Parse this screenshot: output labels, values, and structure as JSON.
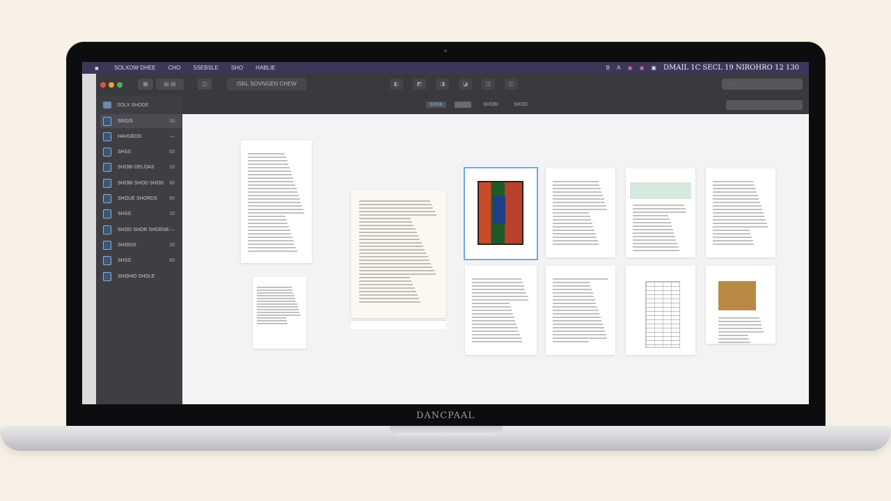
{
  "menubar": {
    "apple_glyph": "■",
    "menus": [
      "SOLXOW DHEE",
      "CHO",
      "SSEBSLE",
      "SHO",
      "HABLIE"
    ],
    "status_icons": [
      "B",
      "A",
      "◉",
      "◉",
      "▣"
    ],
    "clock": "DMAIL 1C SECL 19 NIROHRO  12  130"
  },
  "toolbar": {
    "traffic_colors": [
      "#e0523f",
      "#e6a52a",
      "#4bb35a"
    ],
    "buttons": [
      "▦",
      "▤ ▤",
      "◫"
    ],
    "title": "ISKL SOVNGEN CHEW",
    "center_buttons": [
      "◧",
      "◩",
      "◨",
      "◪",
      "◫",
      "◰"
    ],
    "search_placeholder": "◌  ◌"
  },
  "sidebar": {
    "header": "SOLX SHODE",
    "items": [
      {
        "label": "SRGIS",
        "count": "10",
        "active": true
      },
      {
        "label": "HAVGEOS",
        "count": "—",
        "active": false
      },
      {
        "label": "SHSS",
        "count": "63",
        "active": false
      },
      {
        "label": "SHOBI GELOAS",
        "count": "10",
        "active": false
      },
      {
        "label": "SHOBI SHOD SHOD",
        "count": "60",
        "active": false
      },
      {
        "label": "SHOUE SHORDS",
        "count": "60",
        "active": false
      },
      {
        "label": "SHSS",
        "count": "10",
        "active": false
      },
      {
        "label": "SHOD SHOR SHOENE",
        "count": "—",
        "active": false
      },
      {
        "label": "SHODIS",
        "count": "10",
        "active": false
      },
      {
        "label": "SHSS",
        "count": "60",
        "active": false
      },
      {
        "label": "SHOHIO SHOLE",
        "count": "",
        "active": false
      }
    ]
  },
  "view_tabs": [
    "SHSK",
    "",
    "SHOBI",
    "SHOD"
  ],
  "chin_label": "DANCPAAL",
  "colors": {
    "menubar": "#3d3658",
    "selection": "#6ea7f0",
    "sidebar_icon": "#3b5577"
  }
}
